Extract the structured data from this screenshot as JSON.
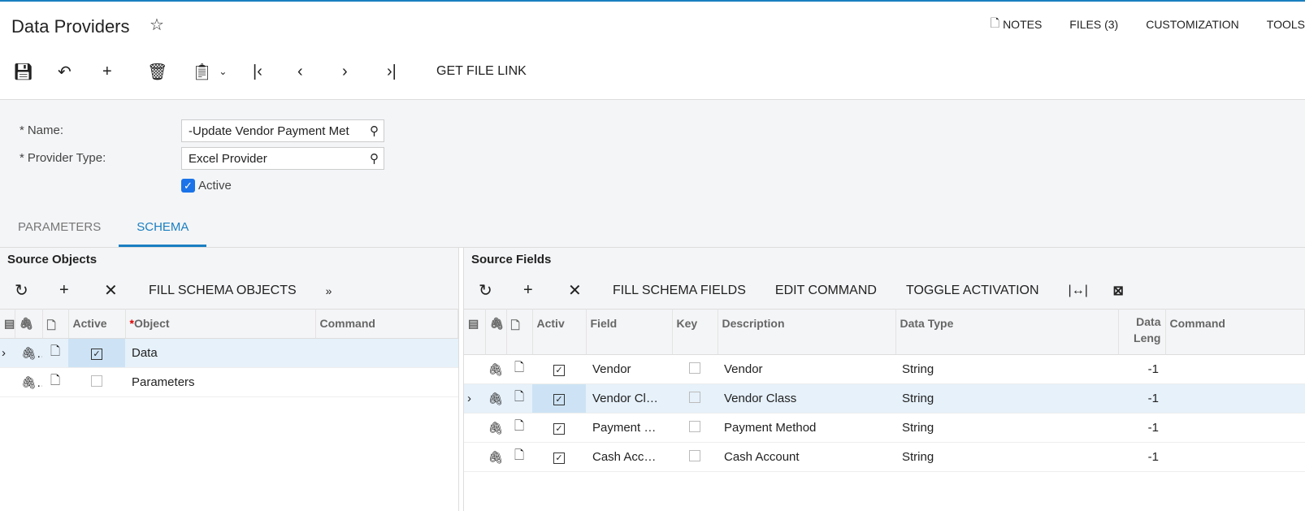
{
  "header": {
    "title": "Data Providers",
    "nav": [
      "NOTES",
      "FILES (3)",
      "CUSTOMIZATION",
      "TOOLS"
    ]
  },
  "toolbar": {
    "get_file_link": "GET FILE LINK"
  },
  "form": {
    "name_label": "Name:",
    "name_value": "-Update Vendor Payment Met",
    "provider_type_label": "Provider Type:",
    "provider_type_value": "Excel Provider",
    "active_label": "Active",
    "active": true
  },
  "tabs": [
    "PARAMETERS",
    "SCHEMA"
  ],
  "active_tab": "SCHEMA",
  "source_objects": {
    "title": "Source Objects",
    "fill_label": "FILL SCHEMA OBJECTS",
    "columns": [
      "Active",
      "Object",
      "Command"
    ],
    "rows": [
      {
        "active": true,
        "object": "Data",
        "command": "",
        "selected": true
      },
      {
        "active": false,
        "object": "Parameters",
        "command": "",
        "selected": false
      }
    ]
  },
  "source_fields": {
    "title": "Source Fields",
    "fill_label": "FILL SCHEMA FIELDS",
    "edit_label": "EDIT COMMAND",
    "toggle_label": "TOGGLE ACTIVATION",
    "columns": [
      "Activ",
      "Field",
      "Key",
      "Description",
      "Data Type",
      "Data Leng",
      "Command"
    ],
    "rows": [
      {
        "active": true,
        "field": "Vendor",
        "key": false,
        "description": "Vendor",
        "data_type": "String",
        "length": "-1",
        "command": ""
      },
      {
        "active": true,
        "field": "Vendor Cl…",
        "key": false,
        "description": "Vendor Class",
        "data_type": "String",
        "length": "-1",
        "command": "",
        "selected": true
      },
      {
        "active": true,
        "field": "Payment …",
        "key": false,
        "description": "Payment Method",
        "data_type": "String",
        "length": "-1",
        "command": ""
      },
      {
        "active": true,
        "field": "Cash Acc…",
        "key": false,
        "description": "Cash Account",
        "data_type": "String",
        "length": "-1",
        "command": ""
      }
    ]
  }
}
